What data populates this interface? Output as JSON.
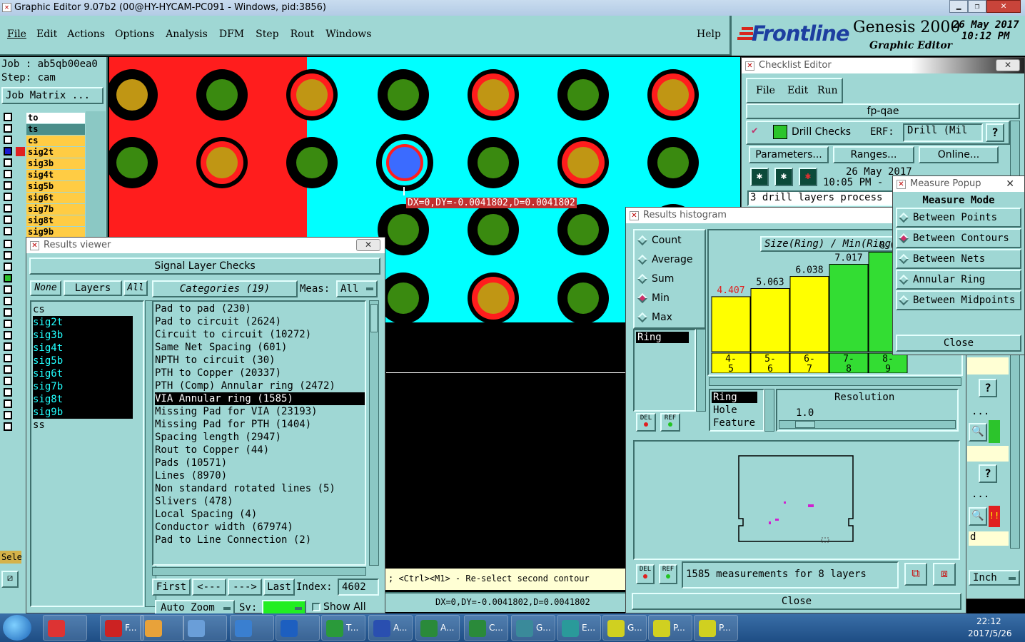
{
  "window": {
    "title": "Graphic Editor 9.07b2 (00@HY-HYCAM-PC091 - Windows, pid:3856)"
  },
  "menu": {
    "items": [
      "File",
      "Edit",
      "Actions",
      "Options",
      "Analysis",
      "DFM",
      "Step",
      "Rout",
      "Windows"
    ],
    "help": "Help"
  },
  "brand": {
    "logo": "Frontline",
    "product": "Genesis 2000",
    "subtitle": "Graphic Editor",
    "date": "26 May 2017",
    "time": "10:12 PM"
  },
  "job": {
    "job_label": "Job : ab5qb00ea0",
    "step_label": "Step: cam",
    "matrix_button": "Job Matrix ..."
  },
  "layers": [
    "to",
    "ts",
    "cs",
    "sig2t",
    "sig3b",
    "sig4t",
    "sig5b",
    "sig6t",
    "sig7b",
    "sig8t",
    "sig9b"
  ],
  "left_tool": {
    "sele": "Sele"
  },
  "canvas": {
    "measure_label": "DX=0,DY=-0.0041802,D=0.0041802",
    "status_hint": "; <Ctrl><M1> - Re-select second contour",
    "status_measure": "DX=0,DY=-0.0041802,D=0.0041802"
  },
  "results_viewer": {
    "title": "Results viewer",
    "header": "Signal Layer Checks",
    "none": "None",
    "layers_btn": "Layers",
    "all_btn": "All",
    "categories_btn": "Categories (19)",
    "meas_label": "Meas:",
    "meas_value": "All",
    "layer_list": [
      "cs",
      "sig2t",
      "sig3b",
      "sig4t",
      "sig5b",
      "sig6t",
      "sig7b",
      "sig8t",
      "sig9b",
      "ss"
    ],
    "categories": [
      "Pad to pad (230)",
      "Pad to circuit (2624)",
      "Circuit to circuit (10272)",
      "Same Net Spacing (601)",
      "NPTH to circuit (30)",
      "PTH to Copper (20337)",
      "PTH (Comp) Annular ring (2472)",
      "VIA Annular ring (1585)",
      "Missing Pad for VIA (23193)",
      "Missing Pad for PTH (1404)",
      "Spacing length (2947)",
      "Rout to Copper (44)",
      "Pads (10571)",
      "Lines (8970)",
      "Non standard rotated lines (5)",
      "Slivers (478)",
      "Local Spacing (4)",
      "Conductor width (67974)",
      "Pad to Line Connection (2)"
    ],
    "first": "First",
    "prev": "<---",
    "next": "--->",
    "last": "Last",
    "index_label": "Index:",
    "index_value": "4602",
    "auto_zoom": "Auto Zoom",
    "sv_label": "Sv:",
    "show_all": "Show All"
  },
  "checklist": {
    "title": "Checklist Editor",
    "menu": [
      "File",
      "Edit",
      "Run"
    ],
    "name": "fp-qae",
    "drill_checks": "Drill Checks",
    "erf_label": "ERF:",
    "erf_value": "Drill (Mil",
    "parameters": "Parameters...",
    "ranges": "Ranges...",
    "online": "Online...",
    "date": "26 May 2017",
    "time": "10:05 PM -",
    "status": "3 drill layers process",
    "help": "?",
    "inch": "Inch",
    "dots": "...",
    "d": "d"
  },
  "histogram": {
    "title": "Results histogram",
    "modes": [
      "Count",
      "Average",
      "Sum",
      "Min",
      "Max"
    ],
    "selected_mode": "Min",
    "chart_title": "Size(Ring) / Min(Ring)",
    "ring_list": "Ring",
    "del": "DEL",
    "ref": "REF",
    "attrs": [
      "Ring",
      "Hole",
      "Feature"
    ],
    "resolution_label": "Resolution",
    "resolution_value": "1.0",
    "summary": "1585 measurements for 8 layers",
    "close": "Close"
  },
  "chart_data": {
    "type": "bar",
    "categories": [
      "4-5",
      "5-6",
      "6-7",
      "7-8",
      "8-9"
    ],
    "values": [
      4.407,
      5.063,
      6.038,
      7.017,
      8.0
    ],
    "value_labels": [
      "4.407",
      "5.063",
      "6.038",
      "7.017",
      "8.0"
    ],
    "colors": [
      "#ffff00",
      "#ffff00",
      "#ffff00",
      "#33dd33",
      "#33dd33"
    ],
    "title": "Size(Ring) / Min(Ring)"
  },
  "measure_popup": {
    "title": "Measure Popup",
    "header": "Measure Mode",
    "options": [
      "Between Points",
      "Between Contours",
      "Between Nets",
      "Annular Ring",
      "Between Midpoints"
    ],
    "selected": "Between Contours",
    "close": "Close"
  },
  "taskbar": {
    "time": "22:12",
    "date": "2017/5/26",
    "items": [
      "F...",
      "T...",
      "A...",
      "A...",
      "C...",
      "G...",
      "E...",
      "G...",
      "P...",
      "P..."
    ]
  }
}
